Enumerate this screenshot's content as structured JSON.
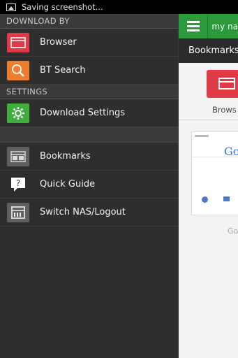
{
  "status_bar": {
    "notification": "Saving screenshot..."
  },
  "drawer": {
    "sections": [
      {
        "header": "DOWNLOAD BY",
        "items": [
          {
            "label": "Browser",
            "icon": "browser-icon",
            "color": "#e03a47"
          },
          {
            "label": "BT Search",
            "icon": "bt-search-icon",
            "color": "#ef7d2e"
          }
        ]
      },
      {
        "header": "SETTINGS",
        "items": [
          {
            "label": "Download Settings",
            "icon": "gear-icon",
            "color": "#3fae3f"
          }
        ]
      },
      {
        "header": "",
        "items": [
          {
            "label": "Bookmarks",
            "icon": "bookmarks-icon",
            "color": "#606060"
          },
          {
            "label": "Quick Guide",
            "icon": "question-icon",
            "color": "#606060"
          },
          {
            "label": "Switch NAS/Logout",
            "icon": "nas-icon",
            "color": "#606060"
          }
        ]
      }
    ]
  },
  "main": {
    "nas_name": "my na",
    "tab_title": "Bookmarks",
    "tile_label": "Brows",
    "thumb_logo": "Go",
    "thumb_label": "Go",
    "accent": "#2a9a3a"
  }
}
